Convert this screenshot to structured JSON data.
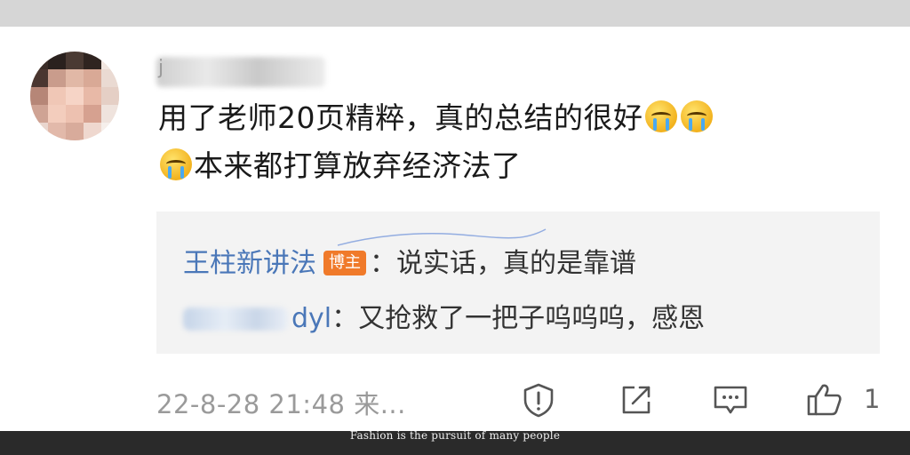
{
  "comment": {
    "username_partial": "j",
    "line1_text": "用了老师20页精粹，真的总结的很好",
    "line1_emojis": [
      "crying-face",
      "crying-face"
    ],
    "line2_emoji": "crying-face",
    "line2_text": "本来都打算放弃经济法了"
  },
  "replies": [
    {
      "name": "王柱新讲法",
      "badge": "博主",
      "separator": "：",
      "text": "说实话，真的是靠谱"
    },
    {
      "name_suffix": "dyl",
      "separator": "：",
      "text": "又抢救了一把子呜呜呜，感恩"
    }
  ],
  "footer": {
    "timestamp": "22-8-28 21:48  来...",
    "like_count": "1",
    "actions": [
      "report-icon",
      "share-icon",
      "comment-icon",
      "like-icon"
    ]
  },
  "watermark": {
    "bottom": "Fashion is the pursuit of many people"
  },
  "colors": {
    "link": "#4a77b8",
    "badge": "#f07a2a",
    "reply_bg": "#f3f3f3",
    "meta": "#9a9a9a"
  }
}
